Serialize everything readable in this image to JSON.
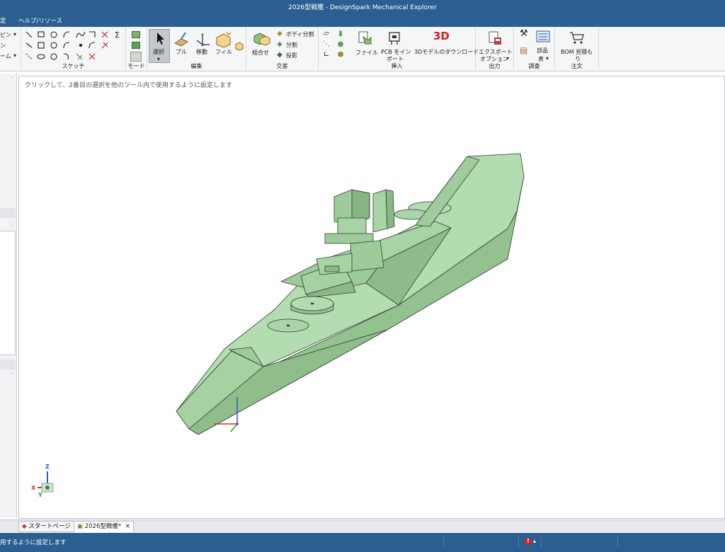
{
  "window": {
    "title": "2026型戦艦 - DesignSpark Mechanical Explorer"
  },
  "menu": {
    "item0": "定",
    "item1": "ヘルプ/リソース"
  },
  "ribbon": {
    "partial_left": [
      "ピン",
      "ン",
      "ーム"
    ],
    "groups": {
      "sketch": "スケッチ",
      "mode": "モード",
      "edit": "編集",
      "intersect": "交差",
      "insert": "挿入",
      "output": "出力",
      "inspect": "調査",
      "order": "注文"
    },
    "buttons": {
      "select": "選択",
      "pull": "プル",
      "move": "移動",
      "fill": "フィル",
      "combine": "組合せ",
      "split_body": "ボディ分割",
      "split": "分割",
      "project": "投影",
      "file": "ファイル",
      "pcb_import_1": "PCB をイン",
      "pcb_import_2": "ポート",
      "download_3d": "3Dモデルのダウンロード",
      "export_options_1": "エクスポート",
      "export_options_2": "オプション",
      "parts_list_1": "部品",
      "parts_list_2": "表",
      "bom_quote_1": "BOM 見積も",
      "bom_quote_2": "り",
      "badge_3d": "3D"
    },
    "icons": [
      "line-icon",
      "rectangle-icon",
      "circle-icon",
      "arc-icon",
      "spline-icon",
      "corner-arc-icon",
      "trim-icon",
      "sigma-icon",
      "polygon-icon",
      "ellipse-icon",
      "tangent-arc-icon",
      "point-icon",
      "offset-icon",
      "cross-icon"
    ]
  },
  "canvas": {
    "hint": "クリックして、2番目の選択を他のツール内で使用するように設定します"
  },
  "triad": {
    "x": "X",
    "y": "Y",
    "z": "Z"
  },
  "tabs": [
    {
      "label": "スタートページ"
    },
    {
      "label": "2026型戦艦*"
    }
  ],
  "status": {
    "message": "用するように設定します"
  },
  "colors": {
    "hull": "#a9d4a7",
    "deck": "#b4dcb1",
    "chrome": "#2b5f91"
  }
}
